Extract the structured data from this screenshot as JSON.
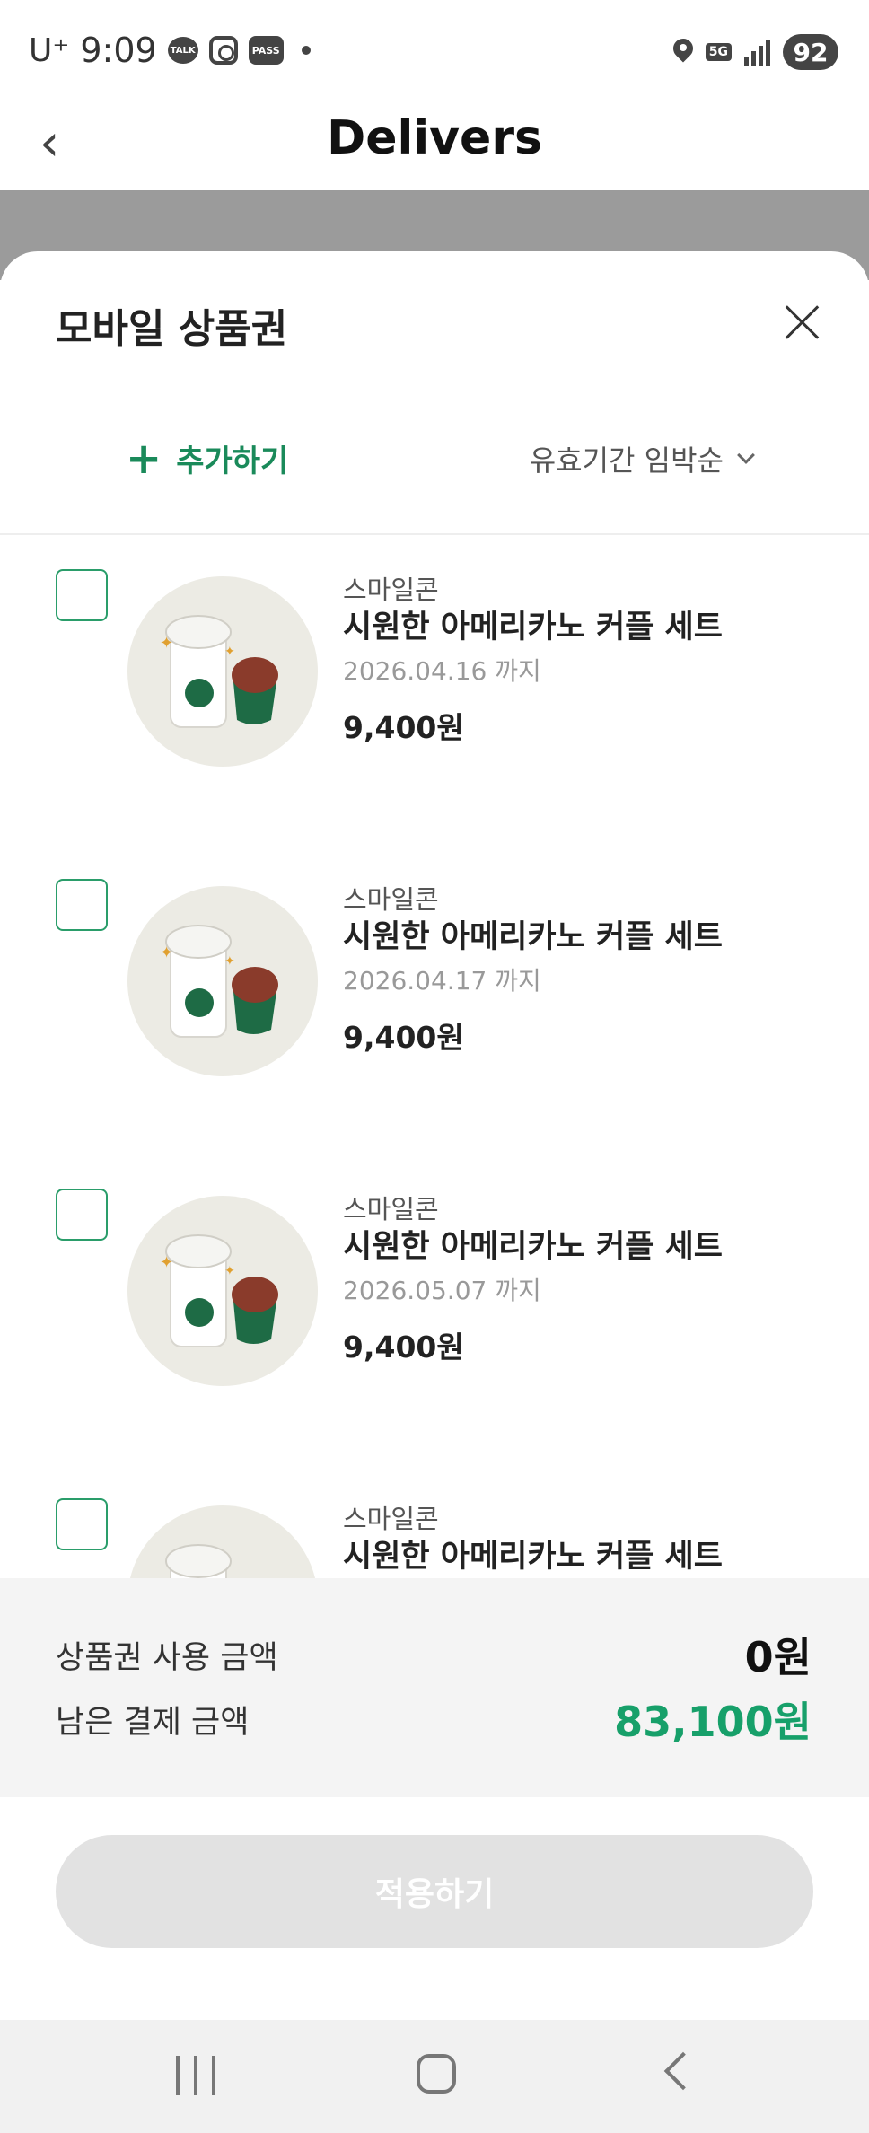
{
  "status_bar": {
    "carrier": "U⁺",
    "time": "9:09",
    "icons": [
      "talk-icon",
      "instagram-icon",
      "pass-icon",
      "notification-dot-icon"
    ],
    "talk_label": "TALK",
    "pass_label": "PASS",
    "network": "5G",
    "battery": "92"
  },
  "header": {
    "title": "Delivers",
    "back_icon": "chevron-left-icon"
  },
  "sheet": {
    "title": "모바일 상품권",
    "add_label": "추가하기",
    "sort_label": "유효기간 임박순",
    "items": [
      {
        "brand": "스마일콘",
        "name": "시원한 아메리카노 커플 세트",
        "expiry": "2026.04.16 까지",
        "price": "9,400원",
        "checked": false
      },
      {
        "brand": "스마일콘",
        "name": "시원한 아메리카노 커플 세트",
        "expiry": "2026.04.17 까지",
        "price": "9,400원",
        "checked": false
      },
      {
        "brand": "스마일콘",
        "name": "시원한 아메리카노 커플 세트",
        "expiry": "2026.05.07 까지",
        "price": "9,400원",
        "checked": false
      },
      {
        "brand": "스마일콘",
        "name": "시원한 아메리카노 커플 세트",
        "expiry": "",
        "price": "",
        "checked": false
      }
    ]
  },
  "summary": {
    "used_label": "상품권 사용 금액",
    "used_value": "0원",
    "remaining_label": "남은 결제 금액",
    "remaining_value": "83,100원"
  },
  "apply_label": "적용하기",
  "colors": {
    "accent_green": "#17a06a",
    "checkbox_border": "#2a9d6a",
    "button_disabled": "#e2e2e2"
  }
}
